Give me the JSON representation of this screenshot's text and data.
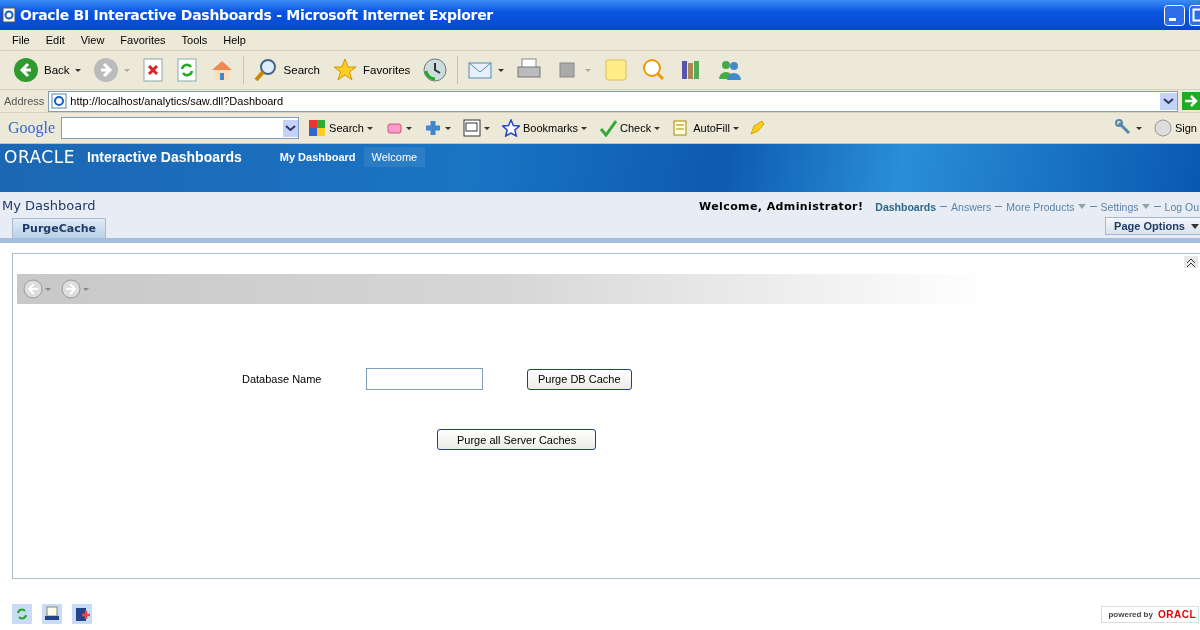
{
  "window": {
    "title": "Oracle BI Interactive Dashboards - Microsoft Internet Explorer"
  },
  "menu": [
    "File",
    "Edit",
    "View",
    "Favorites",
    "Tools",
    "Help"
  ],
  "toolbar": {
    "back": "Back",
    "search": "Search",
    "favorites": "Favorites"
  },
  "address": {
    "label": "Address",
    "url": "http://localhost/analytics/saw.dll?Dashboard"
  },
  "google_bar": {
    "logo": "Google",
    "search": "Search",
    "bookmarks": "Bookmarks",
    "check": "Check",
    "autofill": "AutoFill",
    "sign_in": "Sign"
  },
  "app_header": {
    "brand": "ORACLE",
    "product": "Interactive Dashboards",
    "tabs": [
      {
        "label": "My Dashboard",
        "selected": true
      },
      {
        "label": "Welcome",
        "selected": false
      }
    ]
  },
  "dashboard": {
    "title": "My Dashboard",
    "greeting": "Welcome, Administrator!",
    "links": [
      {
        "label": "Dashboards",
        "selected": true,
        "dropdown": false
      },
      {
        "label": "Answers",
        "selected": false,
        "dropdown": false
      },
      {
        "label": "More Products",
        "selected": false,
        "dropdown": true
      },
      {
        "label": "Settings",
        "selected": false,
        "dropdown": true
      },
      {
        "label": "Log Ou",
        "selected": false,
        "dropdown": false
      }
    ],
    "page_options": "Page Options",
    "pages": [
      {
        "label": "PurgeCache",
        "selected": true
      }
    ]
  },
  "form": {
    "field_label": "Database Name",
    "purge_db": "Purge DB Cache",
    "purge_all": "Purge all Server Caches"
  },
  "footer": {
    "powered_by": "powered by",
    "brand": "ORACL"
  }
}
